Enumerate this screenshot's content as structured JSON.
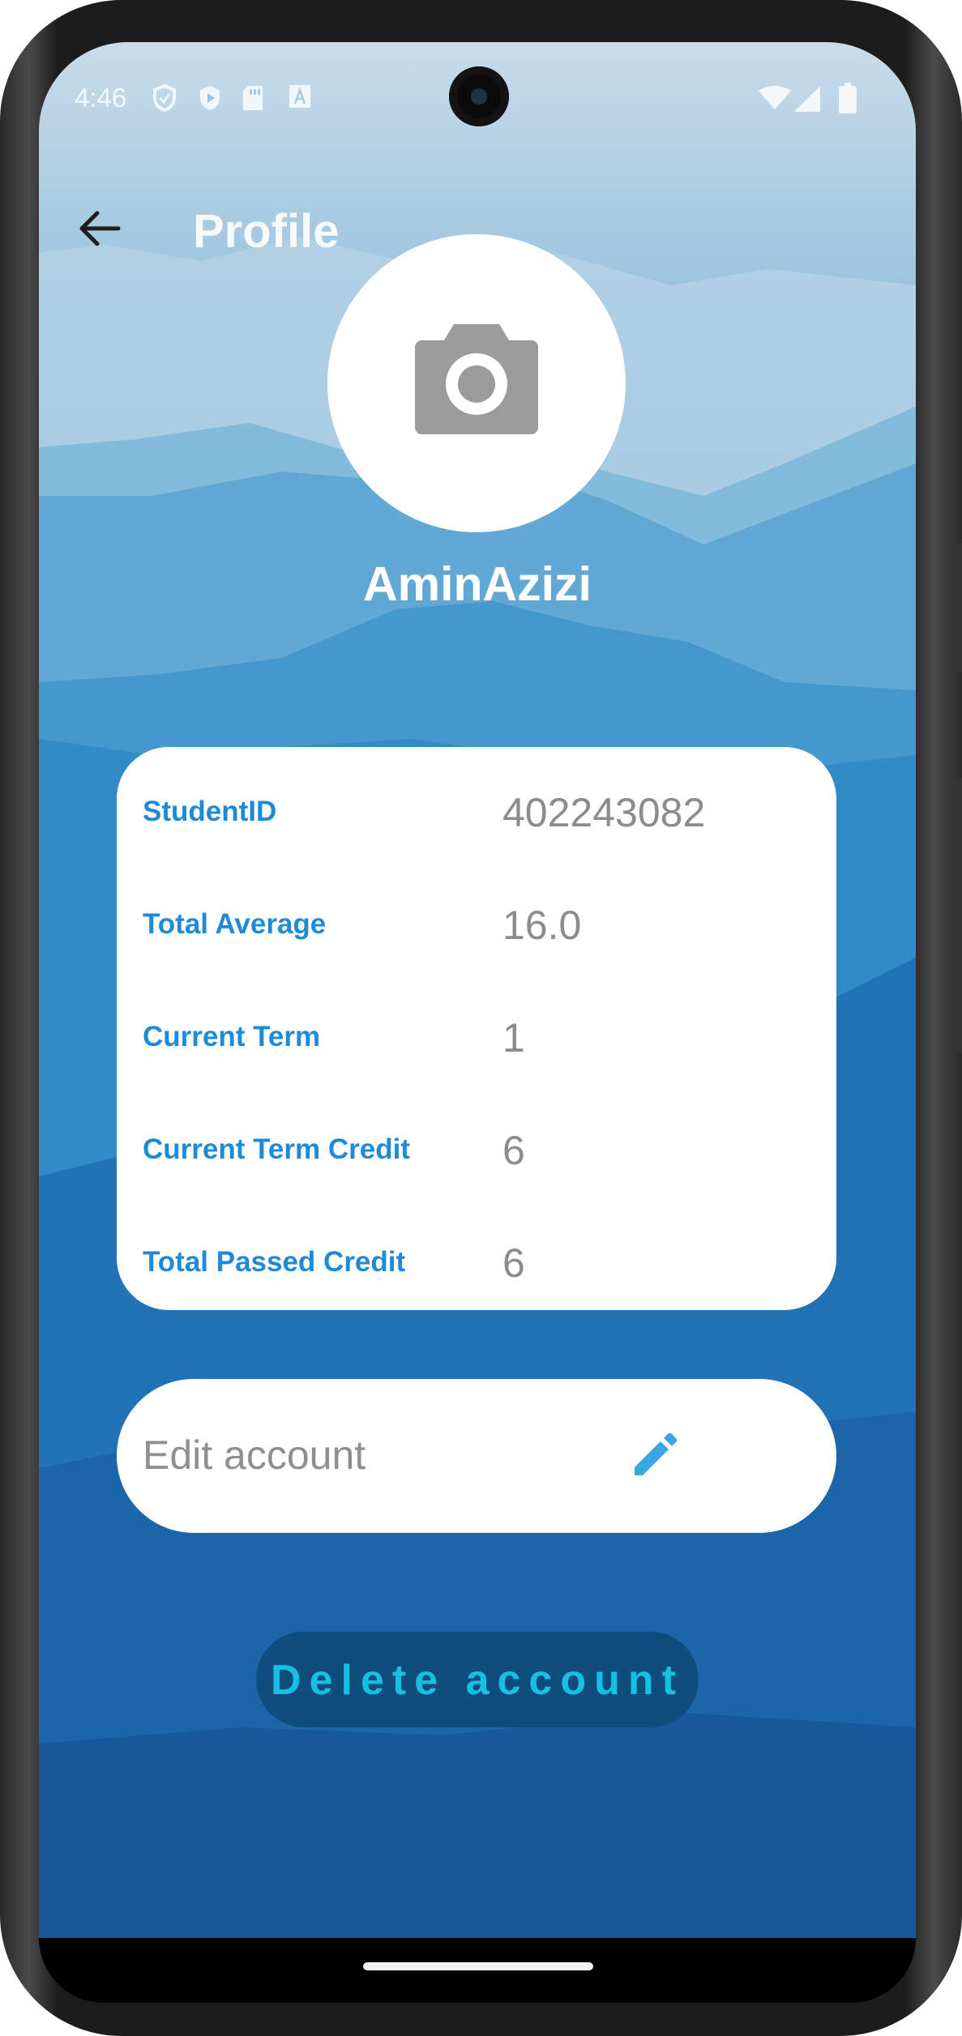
{
  "status_bar": {
    "time": "4:46",
    "left_icons": [
      "shield-outline-icon",
      "shield-play-icon",
      "sd-card-icon",
      "font-a-icon"
    ],
    "right_icons": [
      "wifi-icon",
      "signal-icon",
      "battery-icon"
    ]
  },
  "app_bar": {
    "back_icon": "arrow-left-icon",
    "title": "Profile"
  },
  "profile": {
    "avatar_icon": "camera-icon",
    "username": "AminAzizi"
  },
  "info": {
    "rows": [
      {
        "label": "StudentID",
        "value": "402243082"
      },
      {
        "label": "Total Average",
        "value": "16.0"
      },
      {
        "label": "Current Term",
        "value": "1"
      },
      {
        "label": "Current Term Credit",
        "value": "6"
      },
      {
        "label": "Total Passed Credit",
        "value": "6"
      }
    ]
  },
  "edit": {
    "label": "Edit account",
    "icon": "pencil-icon",
    "icon_color": "#3aa6e6"
  },
  "delete": {
    "label": "Delete account",
    "background": "#0f4e7c",
    "text_color": "#16c0e0"
  },
  "colors": {
    "label_blue": "#1f8ad8",
    "value_gray": "#8c8c8c",
    "card_white": "#ffffff"
  }
}
